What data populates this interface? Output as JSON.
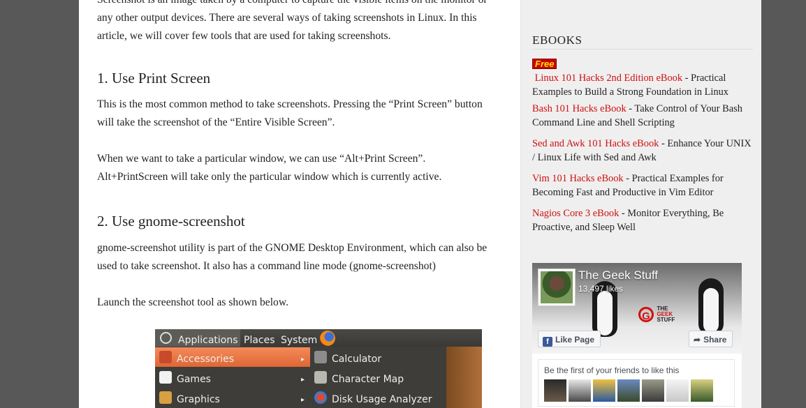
{
  "article": {
    "intro_line1": "Screenshot is an image taken by a computer to capture the visible items on the monitor or",
    "intro_line2": "any other output devices. There are several ways of taking screenshots in Linux. In this",
    "intro_line3": "article, we will cover few tools that are used for taking screenshots.",
    "heading1": "1. Use Print Screen",
    "para1_line1": "This is the most common method to take screenshots. Pressing the “Print Screen” button",
    "para1_line2": "will take the screenshot of the “Entire Visible Screen”.",
    "para2_line1": "When we want to take a particular window, we can use “Alt+Print Screen”.",
    "para2_line2": "Alt+PrintScreen will take only the particular window which is currently active.",
    "heading2": "2. Use gnome-screenshot",
    "para3_line1": "gnome-screenshot utility is part of the GNOME Desktop Environment, which can also be",
    "para3_line2": "used to take screenshot. It also has a command line mode (gnome-screenshot)",
    "para4": "Launch the screenshot tool as shown below."
  },
  "screenshot": {
    "topbar": [
      "Applications",
      "Places",
      "System"
    ],
    "menu_left": [
      {
        "label": "Accessories",
        "icon": "accessories-icon",
        "selected": true
      },
      {
        "label": "Games",
        "icon": "games-icon",
        "selected": false
      },
      {
        "label": "Graphics",
        "icon": "graphics-icon",
        "selected": false
      }
    ],
    "menu_right": [
      {
        "label": "Calculator",
        "icon": "calculator-icon"
      },
      {
        "label": "Character Map",
        "icon": "character-map-icon"
      },
      {
        "label": "Disk Usage Analyzer",
        "icon": "disk-usage-icon"
      }
    ]
  },
  "sidebar": {
    "ebooks_title": "EBOOKS",
    "free_badge": "Free",
    "books": [
      {
        "link": "Linux 101 Hacks 2nd Edition eBook",
        "desc": " - Practical Examples to Build a Strong Foundation in Linux"
      },
      {
        "link": "Bash 101 Hacks eBook",
        "desc": " - Take Control of Your Bash Command Line and Shell Scripting"
      },
      {
        "link": "Sed and Awk 101 Hacks eBook",
        "desc": " - Enhance Your UNIX / Linux Life with Sed and Awk"
      },
      {
        "link": "Vim 101 Hacks eBook",
        "desc": " - Practical Examples for Becoming Fast and Productive in Vim Editor"
      },
      {
        "link": "Nagios Core 3 eBook",
        "desc": " - Monitor Everything, Be Proactive, and Sleep Well"
      }
    ],
    "fb": {
      "page_name": "The Geek Stuff",
      "likes": "13,497 likes",
      "brand_line1": "THE",
      "brand_line2": "GEEK",
      "brand_line3": "STUFF",
      "like_button": "Like Page",
      "share_button": "Share",
      "friends_text": "Be the first of your friends to like this"
    }
  },
  "colors": {
    "link": "#cc1010",
    "menu_selected": "#e8743f",
    "fb_blue": "#3b5998"
  }
}
